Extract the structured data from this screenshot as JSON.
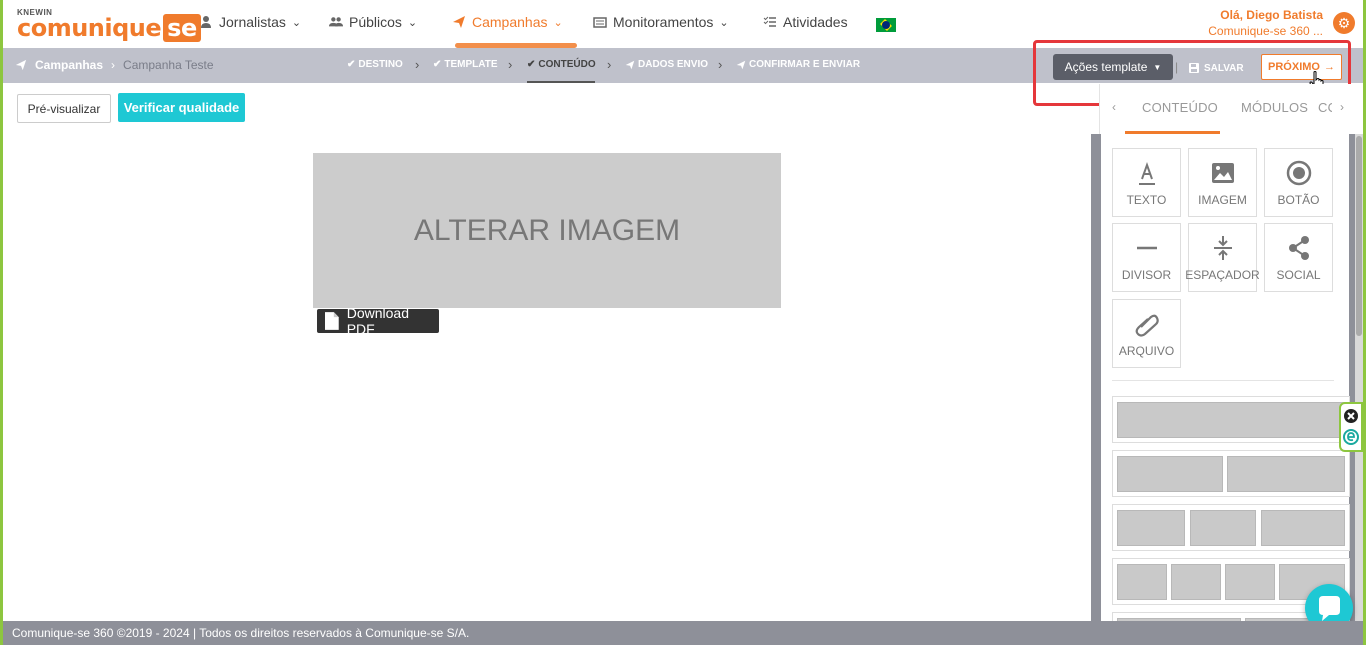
{
  "brand": {
    "small": "KNEWIN",
    "main": "comunique",
    "suffix": "se"
  },
  "nav": {
    "items": [
      {
        "label": "Jornalistas",
        "icon": "user-icon"
      },
      {
        "label": "Públicos",
        "icon": "users-icon"
      },
      {
        "label": "Campanhas",
        "icon": "paper-plane-icon",
        "active": true
      },
      {
        "label": "Monitoramentos",
        "icon": "newspaper-icon"
      },
      {
        "label": "Atividades",
        "icon": "list-check-icon"
      }
    ]
  },
  "user": {
    "greeting": "Olá, Diego Batista",
    "account": "Comunique-se 360 ..."
  },
  "breadcrumb": {
    "root": "Campanhas",
    "current": "Campanha Teste"
  },
  "steps": [
    {
      "label": "DESTINO",
      "icon": "check-circle-icon"
    },
    {
      "label": "TEMPLATE",
      "icon": "check-circle-icon"
    },
    {
      "label": "CONTEÚDO",
      "icon": "check-circle-icon",
      "current": true
    },
    {
      "label": "DADOS ENVIO",
      "icon": "paper-plane-icon"
    },
    {
      "label": "CONFIRMAR E ENVIAR",
      "icon": "paper-plane-icon"
    }
  ],
  "actions": {
    "template_label": "Ações template",
    "separator": "|",
    "save_label": "SALVAR",
    "next_label": "PRÓXIMO"
  },
  "toolbar": {
    "preview_label": "Pré-visualizar",
    "quality_label": "Verificar qualidade"
  },
  "canvas": {
    "image_placeholder": "ALTERAR IMAGEM",
    "pdf_label": "Download PDF"
  },
  "panel": {
    "tabs": [
      {
        "label": "CONTEÚDO",
        "active": true
      },
      {
        "label": "MÓDULOS"
      },
      {
        "label": "CO"
      }
    ],
    "tools": [
      {
        "label": "TEXTO",
        "icon": "text-icon"
      },
      {
        "label": "IMAGEM",
        "icon": "image-icon"
      },
      {
        "label": "BOTÃO",
        "icon": "button-icon"
      },
      {
        "label": "DIVISOR",
        "icon": "divider-icon"
      },
      {
        "label": "ESPAÇADOR",
        "icon": "spacer-icon"
      },
      {
        "label": "SOCIAL",
        "icon": "share-icon"
      },
      {
        "label": "ARQUIVO",
        "icon": "paperclip-icon"
      }
    ],
    "layout_columns": [
      1,
      2,
      3,
      4,
      2
    ]
  },
  "footer": {
    "text": "Comunique-se 360 ©2019 - 2024 | Todos os direitos reservados à Comunique-se S/A."
  },
  "colors": {
    "brand": "#f07b2c",
    "accent": "#1ec8d4",
    "bar": "#bfc1cb",
    "highlight": "#e5373b"
  }
}
